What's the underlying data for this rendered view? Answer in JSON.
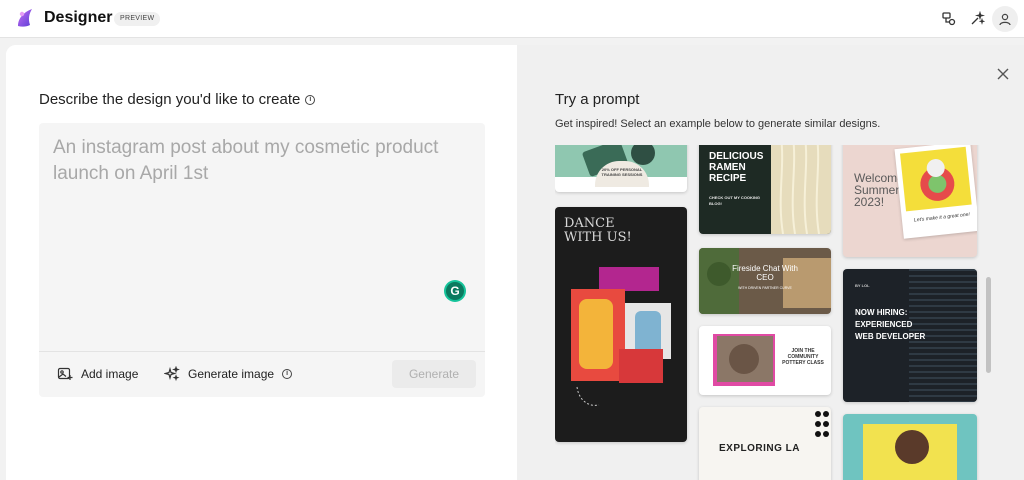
{
  "header": {
    "app_name": "Designer",
    "badge": "PREVIEW",
    "icons": [
      "share-icon",
      "magic-icon",
      "user-icon"
    ]
  },
  "describe": {
    "title": "Describe the design you'd like to create",
    "placeholder": "An instagram post about my cosmetic product launch on April 1st",
    "add_image": "Add image",
    "generate_image": "Generate image",
    "generate_button": "Generate"
  },
  "prompts": {
    "title": "Try a prompt",
    "subtitle": "Get inspired! Select an example below to generate similar designs.",
    "cards": {
      "training": {
        "caption": "20% OFF PERSONAL TRAINING SESSIONS"
      },
      "dance": {
        "title": "DANCE WITH US!"
      },
      "ramen": {
        "title": "DELICIOUS RAMEN RECIPE",
        "sub": "CHECK OUT MY COOKING BLOG!"
      },
      "fireside": {
        "title": "Fireside Chat With CEO",
        "sub": "WITH DRIVEN PARTNER CURVE"
      },
      "community": {
        "title": "JOIN THE COMMUNITY POTTERY CLASS"
      },
      "explore": {
        "title": "EXPLORING LA"
      },
      "summer": {
        "title": "Welcome Summer 2023!",
        "note": "Let's make it a great one!"
      },
      "hiring": {
        "tag": "BY LOL",
        "title": "NOW HIRING: EXPERIENCED WEB DEVELOPER"
      }
    }
  },
  "colors": {
    "accent": "#7a5af8",
    "panel_right": "#f0f0f0",
    "grammarly": "#15c39a"
  }
}
